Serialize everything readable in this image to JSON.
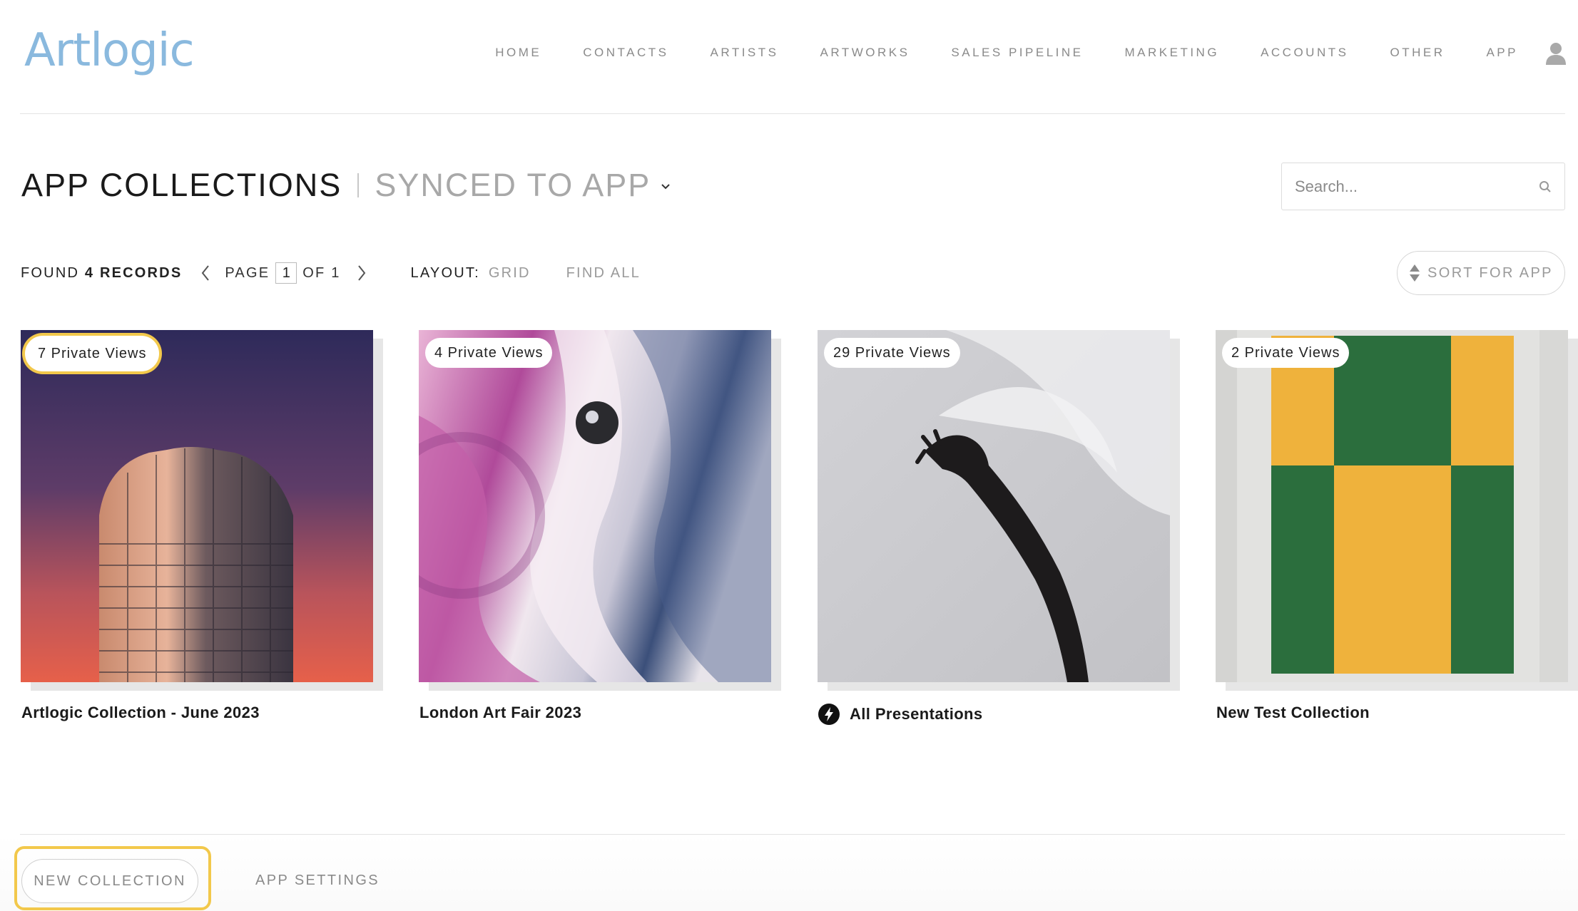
{
  "header": {
    "logo": "Artlogic",
    "nav": [
      "HOME",
      "CONTACTS",
      "ARTISTS",
      "ARTWORKS",
      "SALES PIPELINE",
      "MARKETING",
      "ACCOUNTS",
      "OTHER",
      "APP"
    ],
    "user_icon": "user-icon"
  },
  "page": {
    "title": "APP COLLECTIONS",
    "subtitle": "SYNCED TO APP",
    "search_placeholder": "Search..."
  },
  "toolbar": {
    "found_prefix": "FOUND",
    "found_count": "4 RECORDS",
    "page_label": "PAGE",
    "page_current": "1",
    "page_of": "OF 1",
    "layout_label": "LAYOUT:",
    "layout_value": "GRID",
    "find_all": "FIND ALL",
    "sort_label": "SORT FOR APP"
  },
  "collections": [
    {
      "badge": "7 Private Views",
      "title": "Artlogic Collection - June 2023",
      "highlighted": true
    },
    {
      "badge": "4 Private Views",
      "title": "London Art Fair 2023",
      "highlighted": false
    },
    {
      "badge": "29 Private Views",
      "title": "All Presentations",
      "highlighted": false,
      "icon": "bolt-icon"
    },
    {
      "badge": "2 Private Views",
      "title": "New Test Collection",
      "highlighted": false
    }
  ],
  "footer": {
    "new_collection": "NEW COLLECTION",
    "app_settings": "APP SETTINGS"
  },
  "colors": {
    "logo": "#8ab9de",
    "highlight": "#f2c84b",
    "muted_text": "#9a9a9a"
  }
}
